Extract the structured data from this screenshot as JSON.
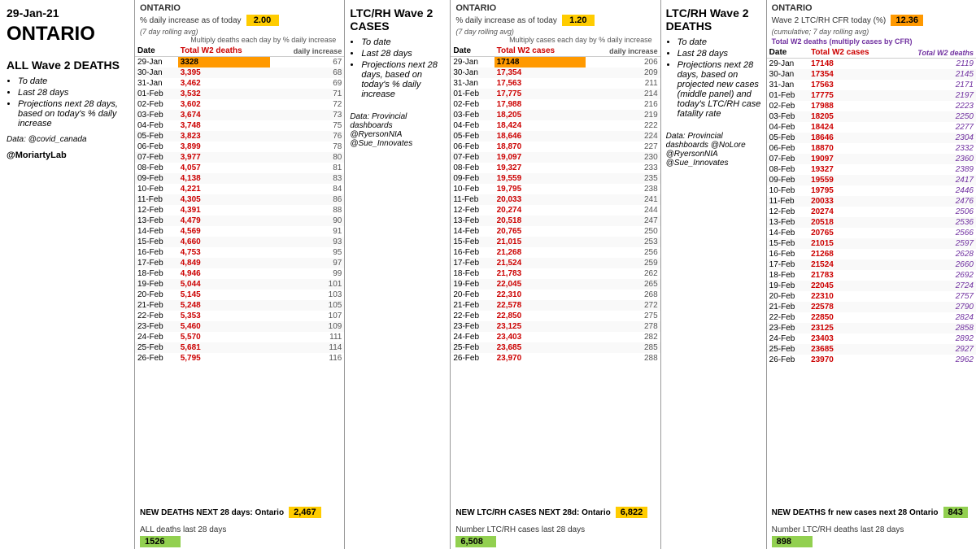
{
  "date": "29-Jan-21",
  "region": "ONTARIO",
  "moriarty": "@MoriartyLab",
  "panel1": {
    "region": "ONTARIO",
    "metric_label": "% daily increase as of today",
    "metric_value": "2.00",
    "rolling_avg": "(7 day rolling avg)",
    "multiply_label": "Multiply deaths each day by % daily increase",
    "title": "ALL Wave 2 DEATHS",
    "bullets": [
      "To date",
      "Last 28 days",
      "Projections next 28 days, based on today's % daily increase"
    ],
    "data_credit": "Data: @covid_canada",
    "col1": "Date",
    "col2": "Total W2 deaths",
    "col3": "daily increase",
    "rows": [
      [
        "29-Jan",
        "3328",
        "67"
      ],
      [
        "30-Jan",
        "3,395",
        "68"
      ],
      [
        "31-Jan",
        "3,462",
        "69"
      ],
      [
        "01-Feb",
        "3,532",
        "71"
      ],
      [
        "02-Feb",
        "3,602",
        "72"
      ],
      [
        "03-Feb",
        "3,674",
        "73"
      ],
      [
        "04-Feb",
        "3,748",
        "75"
      ],
      [
        "05-Feb",
        "3,823",
        "76"
      ],
      [
        "06-Feb",
        "3,899",
        "78"
      ],
      [
        "07-Feb",
        "3,977",
        "80"
      ],
      [
        "08-Feb",
        "4,057",
        "81"
      ],
      [
        "09-Feb",
        "4,138",
        "83"
      ],
      [
        "10-Feb",
        "4,221",
        "84"
      ],
      [
        "11-Feb",
        "4,305",
        "86"
      ],
      [
        "12-Feb",
        "4,391",
        "88"
      ],
      [
        "13-Feb",
        "4,479",
        "90"
      ],
      [
        "14-Feb",
        "4,569",
        "91"
      ],
      [
        "15-Feb",
        "4,660",
        "93"
      ],
      [
        "16-Feb",
        "4,753",
        "95"
      ],
      [
        "17-Feb",
        "4,849",
        "97"
      ],
      [
        "18-Feb",
        "4,946",
        "99"
      ],
      [
        "19-Feb",
        "5,044",
        "101"
      ],
      [
        "20-Feb",
        "5,145",
        "103"
      ],
      [
        "21-Feb",
        "5,248",
        "105"
      ],
      [
        "22-Feb",
        "5,353",
        "107"
      ],
      [
        "23-Feb",
        "5,460",
        "109"
      ],
      [
        "24-Feb",
        "5,570",
        "111"
      ],
      [
        "25-Feb",
        "5,681",
        "114"
      ],
      [
        "26-Feb",
        "5,795",
        "116"
      ]
    ],
    "footer_label": "NEW DEATHS NEXT 28 days:  Ontario",
    "footer_value": "2,467",
    "last28_label": "ALL deaths last 28 days",
    "last28_value": "1526"
  },
  "panel2": {
    "region": "ONTARIO",
    "metric_label": "% daily increase as of today",
    "metric_value": "1.20",
    "rolling_avg": "(7 day rolling avg)",
    "multiply_label": "Multiply cases each day by % daily increase",
    "title": "LTC/RH Wave 2 CASES",
    "bullets": [
      "To date",
      "Last 28 days",
      "Projections next 28 days, based on today's % daily increase"
    ],
    "data_credit": "Data: Provincial dashboards @RyersonNIA @Sue_Innovates",
    "col1": "Date",
    "col2": "Total W2 cases",
    "col3": "daily increase",
    "rows": [
      [
        "29-Jan",
        "17148",
        "206"
      ],
      [
        "30-Jan",
        "17,354",
        "209"
      ],
      [
        "31-Jan",
        "17,563",
        "211"
      ],
      [
        "01-Feb",
        "17,775",
        "214"
      ],
      [
        "02-Feb",
        "17,988",
        "216"
      ],
      [
        "03-Feb",
        "18,205",
        "219"
      ],
      [
        "04-Feb",
        "18,424",
        "222"
      ],
      [
        "05-Feb",
        "18,646",
        "224"
      ],
      [
        "06-Feb",
        "18,870",
        "227"
      ],
      [
        "07-Feb",
        "19,097",
        "230"
      ],
      [
        "08-Feb",
        "19,327",
        "233"
      ],
      [
        "09-Feb",
        "19,559",
        "235"
      ],
      [
        "10-Feb",
        "19,795",
        "238"
      ],
      [
        "11-Feb",
        "20,033",
        "241"
      ],
      [
        "12-Feb",
        "20,274",
        "244"
      ],
      [
        "13-Feb",
        "20,518",
        "247"
      ],
      [
        "14-Feb",
        "20,765",
        "250"
      ],
      [
        "15-Feb",
        "21,015",
        "253"
      ],
      [
        "16-Feb",
        "21,268",
        "256"
      ],
      [
        "17-Feb",
        "21,524",
        "259"
      ],
      [
        "18-Feb",
        "21,783",
        "262"
      ],
      [
        "19-Feb",
        "22,045",
        "265"
      ],
      [
        "20-Feb",
        "22,310",
        "268"
      ],
      [
        "21-Feb",
        "22,578",
        "272"
      ],
      [
        "22-Feb",
        "22,850",
        "275"
      ],
      [
        "23-Feb",
        "23,125",
        "278"
      ],
      [
        "24-Feb",
        "23,403",
        "282"
      ],
      [
        "25-Feb",
        "23,685",
        "285"
      ],
      [
        "26-Feb",
        "23,970",
        "288"
      ]
    ],
    "footer_label": "NEW LTC/RH CASES NEXT 28d:  Ontario",
    "footer_value": "6,822",
    "last28_label": "Number LTC/RH cases last 28 days",
    "last28_value": "6,508"
  },
  "panel3": {
    "region": "ONTARIO",
    "metric_label": "Wave 2 LTC/RH CFR today (%)",
    "metric_value": "12.36",
    "rolling_avg": "(cumulative; 7 day rolling avg)",
    "col_total_label": "Total W2 deaths (multiply cases by CFR)",
    "title": "LTC/RH Wave 2 DEATHS",
    "bullets": [
      "To date",
      "Last 28 days",
      "Projections next 28 days, based on projected new cases (middle panel) and today's LTC/RH case fatality rate"
    ],
    "data_credit": "Data: Provincial dashboards @NoLore @RyersonNIA @Sue_Innovates",
    "col1": "Date",
    "col2": "Total W2 cases",
    "col3": "Total W2 deaths",
    "rows": [
      [
        "29-Jan",
        "17148",
        "2119"
      ],
      [
        "30-Jan",
        "17354",
        "2145"
      ],
      [
        "31-Jan",
        "17563",
        "2171"
      ],
      [
        "01-Feb",
        "17775",
        "2197"
      ],
      [
        "02-Feb",
        "17988",
        "2223"
      ],
      [
        "03-Feb",
        "18205",
        "2250"
      ],
      [
        "04-Feb",
        "18424",
        "2277"
      ],
      [
        "05-Feb",
        "18646",
        "2304"
      ],
      [
        "06-Feb",
        "18870",
        "2332"
      ],
      [
        "07-Feb",
        "19097",
        "2360"
      ],
      [
        "08-Feb",
        "19327",
        "2389"
      ],
      [
        "09-Feb",
        "19559",
        "2417"
      ],
      [
        "10-Feb",
        "19795",
        "2446"
      ],
      [
        "11-Feb",
        "20033",
        "2476"
      ],
      [
        "12-Feb",
        "20274",
        "2506"
      ],
      [
        "13-Feb",
        "20518",
        "2536"
      ],
      [
        "14-Feb",
        "20765",
        "2566"
      ],
      [
        "15-Feb",
        "21015",
        "2597"
      ],
      [
        "16-Feb",
        "21268",
        "2628"
      ],
      [
        "17-Feb",
        "21524",
        "2660"
      ],
      [
        "18-Feb",
        "21783",
        "2692"
      ],
      [
        "19-Feb",
        "22045",
        "2724"
      ],
      [
        "20-Feb",
        "22310",
        "2757"
      ],
      [
        "21-Feb",
        "22578",
        "2790"
      ],
      [
        "22-Feb",
        "22850",
        "2824"
      ],
      [
        "23-Feb",
        "23125",
        "2858"
      ],
      [
        "24-Feb",
        "23403",
        "2892"
      ],
      [
        "25-Feb",
        "23685",
        "2927"
      ],
      [
        "26-Feb",
        "23970",
        "2962"
      ]
    ],
    "footer_label": "NEW DEATHS fr new cases next 28  Ontario",
    "footer_value": "843",
    "last28_label": "Number LTC/RH deaths last 28 days",
    "last28_value": "898"
  }
}
